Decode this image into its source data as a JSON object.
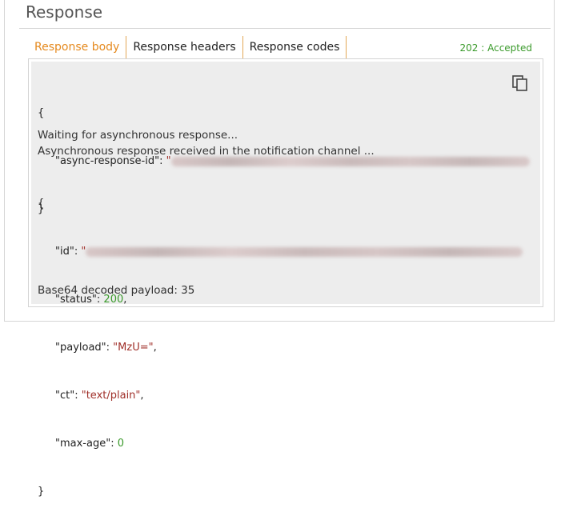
{
  "title": "Response",
  "tabs": [
    {
      "label": "Response body",
      "active": true
    },
    {
      "label": "Response headers",
      "active": false
    },
    {
      "label": "Response codes",
      "active": false
    }
  ],
  "status": "202 : Accepted",
  "body": {
    "open_brace": "{",
    "close_brace": "}",
    "async_key": "\"async-response-id\": ",
    "async_quote": "\"",
    "waiting": "Waiting for asynchronous response...",
    "received": "Asynchronous response received in the notification channel ...",
    "id_key": "\"id\": ",
    "id_quote": "\"",
    "status_key": "\"status\": ",
    "status_value": "200",
    "payload_key": "\"payload\": ",
    "payload_value": "\"MzU=\"",
    "ct_key": "\"ct\": ",
    "ct_value": "\"text/plain\"",
    "maxage_key": "\"max-age\": ",
    "maxage_value": "0",
    "comma": ",",
    "decoded": "Base64 decoded payload: 35"
  },
  "icons": {
    "copy": "copy-icon"
  },
  "colors": {
    "accent": "#e58a1f",
    "success": "#3a9a2b",
    "string": "#a0302a"
  }
}
